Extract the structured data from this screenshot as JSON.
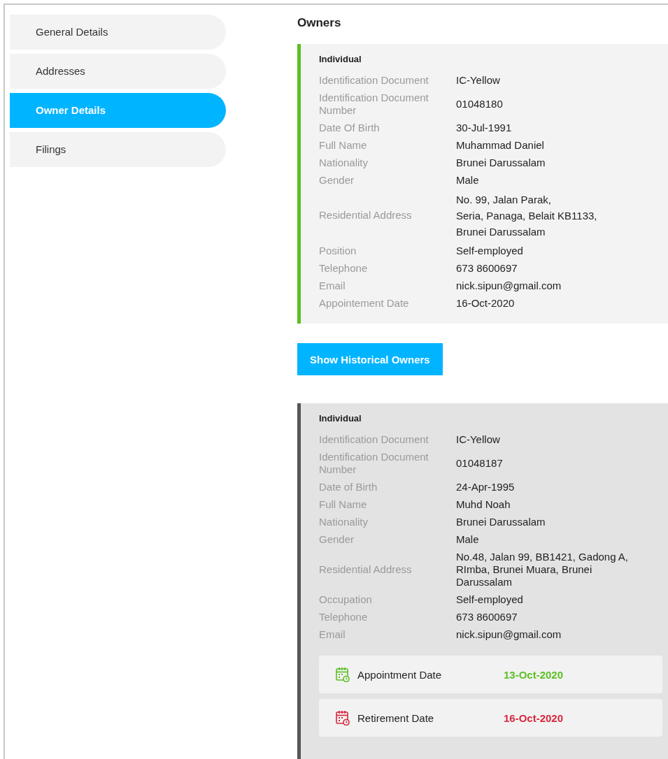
{
  "sidebar": {
    "items": [
      {
        "label": "General Details",
        "selected": false
      },
      {
        "label": "Addresses",
        "selected": false
      },
      {
        "label": "Owner Details",
        "selected": true
      },
      {
        "label": "Filings",
        "selected": false
      }
    ]
  },
  "title": "Owners",
  "cards": [
    {
      "kind": "current",
      "type": "Individual",
      "fields": [
        {
          "label": "Identification Document",
          "value": "IC-Yellow"
        },
        {
          "label": "Identification Document Number",
          "value": "01048180"
        },
        {
          "label": "Date Of Birth",
          "value": "30-Jul-1991"
        },
        {
          "label": "Full Name",
          "value": "Muhammad Daniel"
        },
        {
          "label": "Nationality",
          "value": "Brunei Darussalam"
        },
        {
          "label": "Gender",
          "value": "Male"
        },
        {
          "label": "Residential Address",
          "lines": [
            "No. 99, Jalan Parak,",
            "Seria, Panaga, Belait KB1133,",
            "Brunei Darussalam"
          ]
        },
        {
          "label": "Position",
          "value": "Self-employed"
        },
        {
          "label": "Telephone",
          "value": "673 8600697"
        },
        {
          "label": "Email",
          "value": "nick.sipun@gmail.com"
        },
        {
          "label": "Appointement Date",
          "value": "16-Oct-2020"
        }
      ]
    }
  ],
  "history_button": "Show Historical Owners",
  "historical_cards": [
    {
      "kind": "historical",
      "type": "Individual",
      "fields": [
        {
          "label": "Identification Document",
          "value": "IC-Yellow"
        },
        {
          "label": "Identification Document Number",
          "value": "01048187"
        },
        {
          "label": "Date of Birth",
          "value": "24-Apr-1995"
        },
        {
          "label": "Full Name",
          "value": "Muhd Noah"
        },
        {
          "label": "Nationality",
          "value": "Brunei Darussalam"
        },
        {
          "label": "Gender",
          "value": "Male"
        },
        {
          "label": "Residential Address",
          "value": "No.48, Jalan 99, BB1421, Gadong A, RImba, Brunei Muara, Brunei Darussalam"
        },
        {
          "label": "Occupation",
          "value": "Self-employed"
        },
        {
          "label": "Telephone",
          "value": "673 8600697"
        },
        {
          "label": "Email",
          "value": "nick.sipun@gmail.com"
        }
      ],
      "dates": [
        {
          "kind": "appointment",
          "label": "Appointment Date",
          "value": "13-Oct-2020"
        },
        {
          "kind": "retirement",
          "label": "Retirement Date",
          "value": "16-Oct-2020"
        }
      ]
    }
  ]
}
